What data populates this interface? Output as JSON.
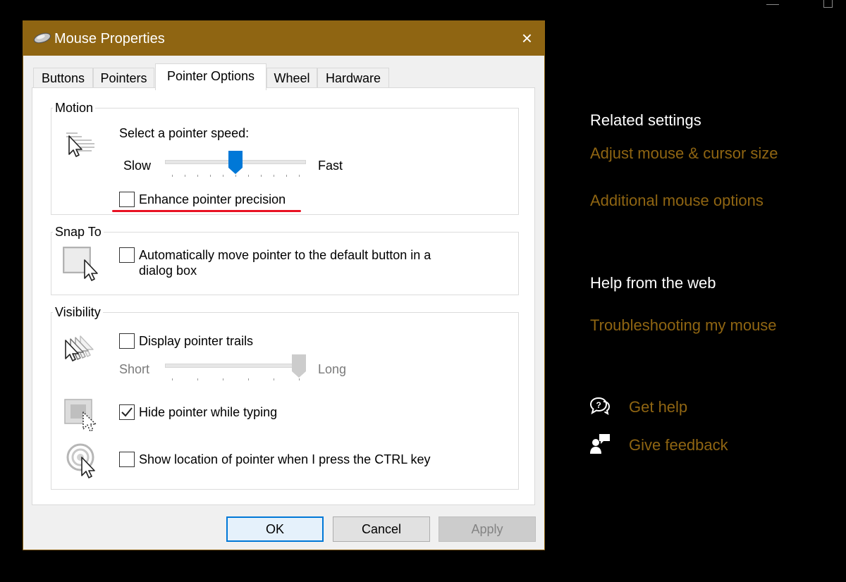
{
  "dialog": {
    "title": "Mouse Properties",
    "close_glyph": "×",
    "tabs": [
      {
        "label": "Buttons",
        "active": false
      },
      {
        "label": "Pointers",
        "active": false
      },
      {
        "label": "Pointer Options",
        "active": true
      },
      {
        "label": "Wheel",
        "active": false
      },
      {
        "label": "Hardware",
        "active": false
      }
    ],
    "motion": {
      "group_label": "Motion",
      "speed_label": "Select a pointer speed:",
      "slow_label": "Slow",
      "fast_label": "Fast",
      "speed_level": 0.5,
      "enhance_precision": {
        "label": "Enhance pointer precision",
        "checked": false
      }
    },
    "snap_to": {
      "group_label": "Snap To",
      "auto_move": {
        "label_line1": "Automatically move pointer to the default button in a",
        "label_line2": "dialog box",
        "checked": false
      }
    },
    "visibility": {
      "group_label": "Visibility",
      "trails": {
        "label": "Display pointer trails",
        "checked": false
      },
      "short_label": "Short",
      "long_label": "Long",
      "trail_level": 1.0,
      "hide_typing": {
        "label": "Hide pointer while typing",
        "checked": true
      },
      "show_location": {
        "label": "Show location of pointer when I press the CTRL key",
        "checked": false
      }
    },
    "buttons": {
      "ok": "OK",
      "cancel": "Cancel",
      "apply": "Apply"
    }
  },
  "settings_panel": {
    "related_heading": "Related settings",
    "related_links": [
      "Adjust mouse & cursor size",
      "Additional mouse options"
    ],
    "help_heading": "Help from the web",
    "help_links": [
      "Troubleshooting my mouse"
    ],
    "get_help": "Get help",
    "give_feedback": "Give feedback"
  },
  "colors": {
    "accent": "#8f6512",
    "slider_thumb": "#0078d7",
    "highlight_underline": "#e81123"
  }
}
